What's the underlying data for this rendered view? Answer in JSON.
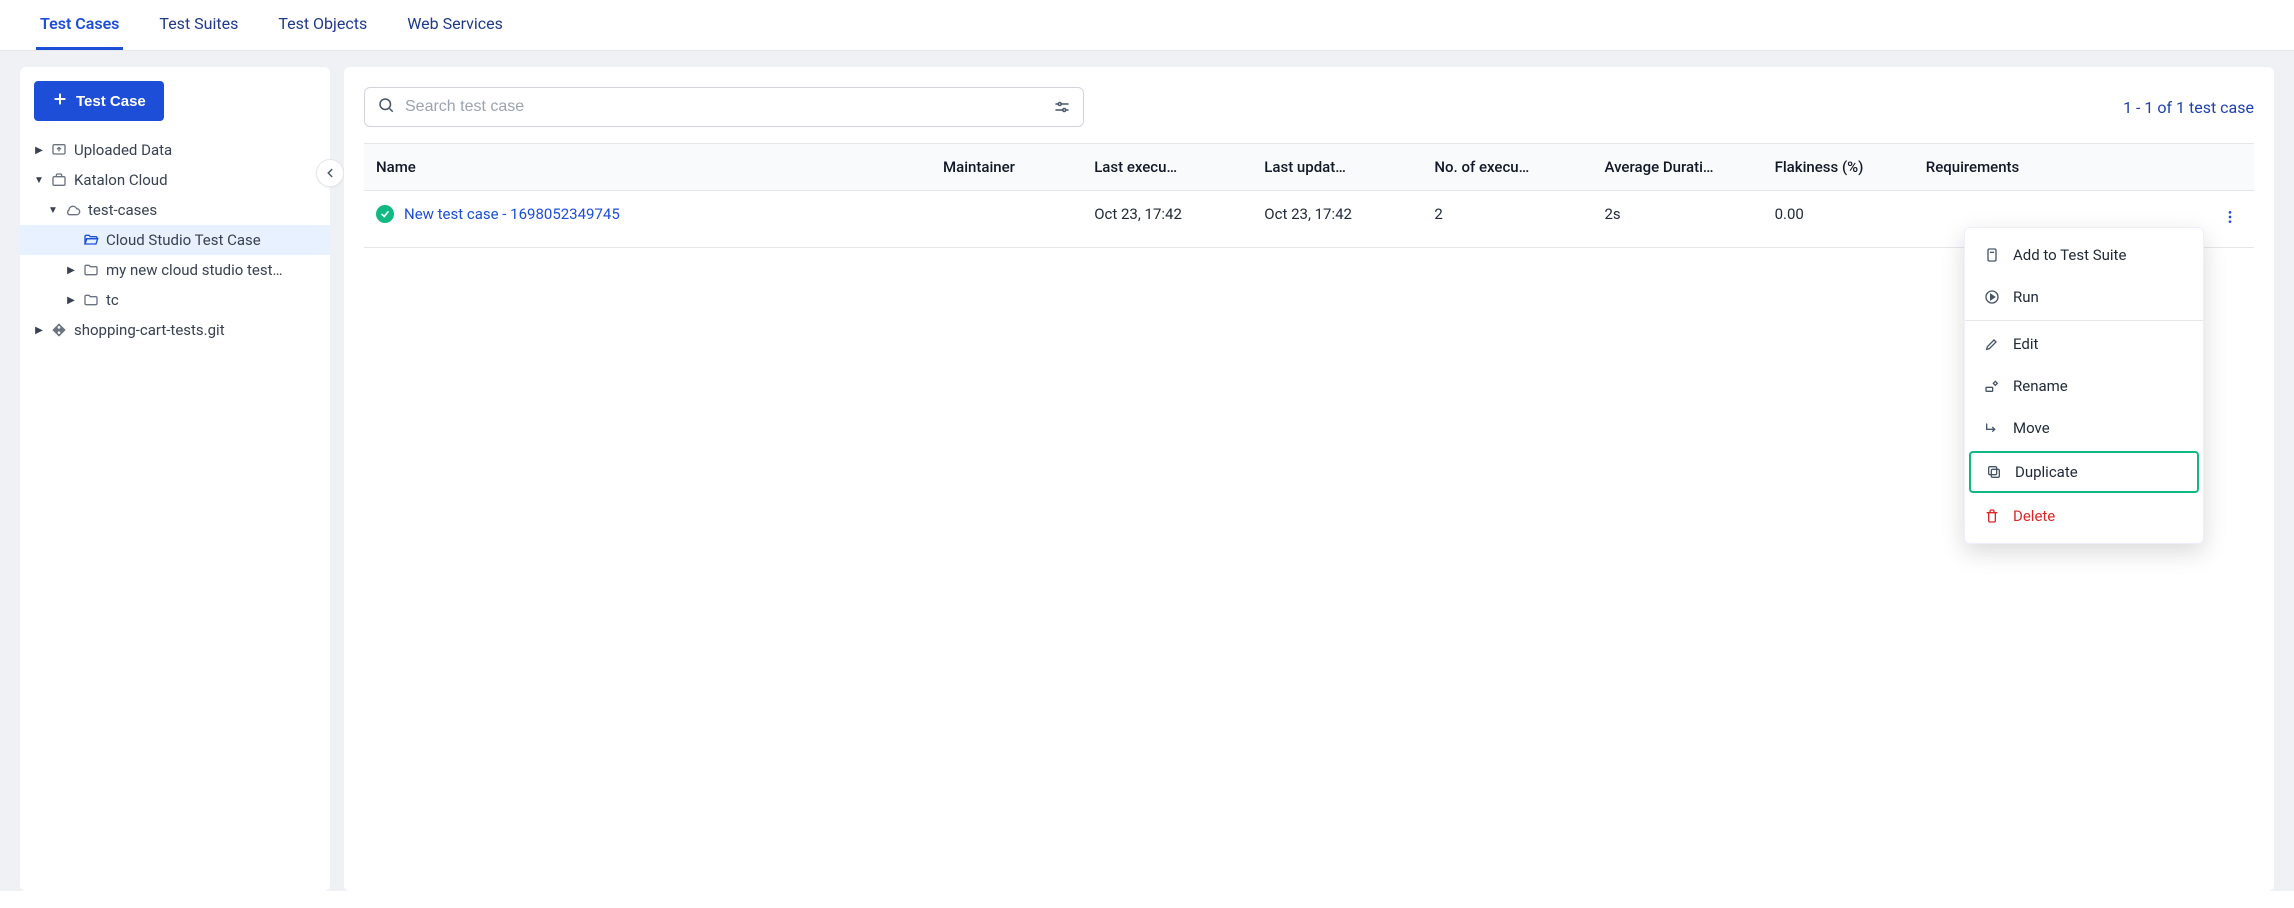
{
  "tabs": [
    {
      "label": "Test Cases",
      "active": true
    },
    {
      "label": "Test Suites",
      "active": false
    },
    {
      "label": "Test Objects",
      "active": false
    },
    {
      "label": "Web Services",
      "active": false
    }
  ],
  "sidebar": {
    "add_button_label": "Test Case",
    "tree": [
      {
        "label": "Uploaded Data",
        "indent": 0,
        "arrow": "right",
        "icon": "upload",
        "selected": false
      },
      {
        "label": "Katalon Cloud",
        "indent": 0,
        "arrow": "down",
        "icon": "briefcase",
        "selected": false
      },
      {
        "label": "test-cases",
        "indent": 1,
        "arrow": "down",
        "icon": "cloud",
        "selected": false
      },
      {
        "label": "Cloud Studio Test Case",
        "indent": 2,
        "arrow": "",
        "icon": "folder-open",
        "selected": true
      },
      {
        "label": "my new cloud studio test…",
        "indent": 2,
        "arrow": "right",
        "icon": "folder",
        "selected": false
      },
      {
        "label": "tc",
        "indent": 2,
        "arrow": "right",
        "icon": "folder",
        "selected": false
      },
      {
        "label": "shopping-cart-tests.git",
        "indent": 0,
        "arrow": "right",
        "icon": "git",
        "selected": false
      }
    ]
  },
  "search": {
    "placeholder": "Search test case"
  },
  "count_label": "1 - 1 of 1 test case",
  "columns": {
    "name": "Name",
    "maintainer": "Maintainer",
    "last_executed": "Last execu…",
    "last_updated": "Last updat…",
    "num_exec": "No. of execu…",
    "avg_duration": "Average Durati…",
    "flakiness": "Flakiness (%)",
    "requirements": "Requirements"
  },
  "rows": [
    {
      "status": "passed",
      "name": "New test case - 1698052349745",
      "maintainer": "",
      "last_executed": "Oct 23, 17:42",
      "last_updated": "Oct 23, 17:42",
      "num_exec": "2",
      "avg_duration": "2s",
      "flakiness": "0.00",
      "requirements": ""
    }
  ],
  "menu": {
    "add_to_suite": "Add to Test Suite",
    "run": "Run",
    "edit": "Edit",
    "rename": "Rename",
    "move": "Move",
    "duplicate": "Duplicate",
    "delete": "Delete"
  }
}
